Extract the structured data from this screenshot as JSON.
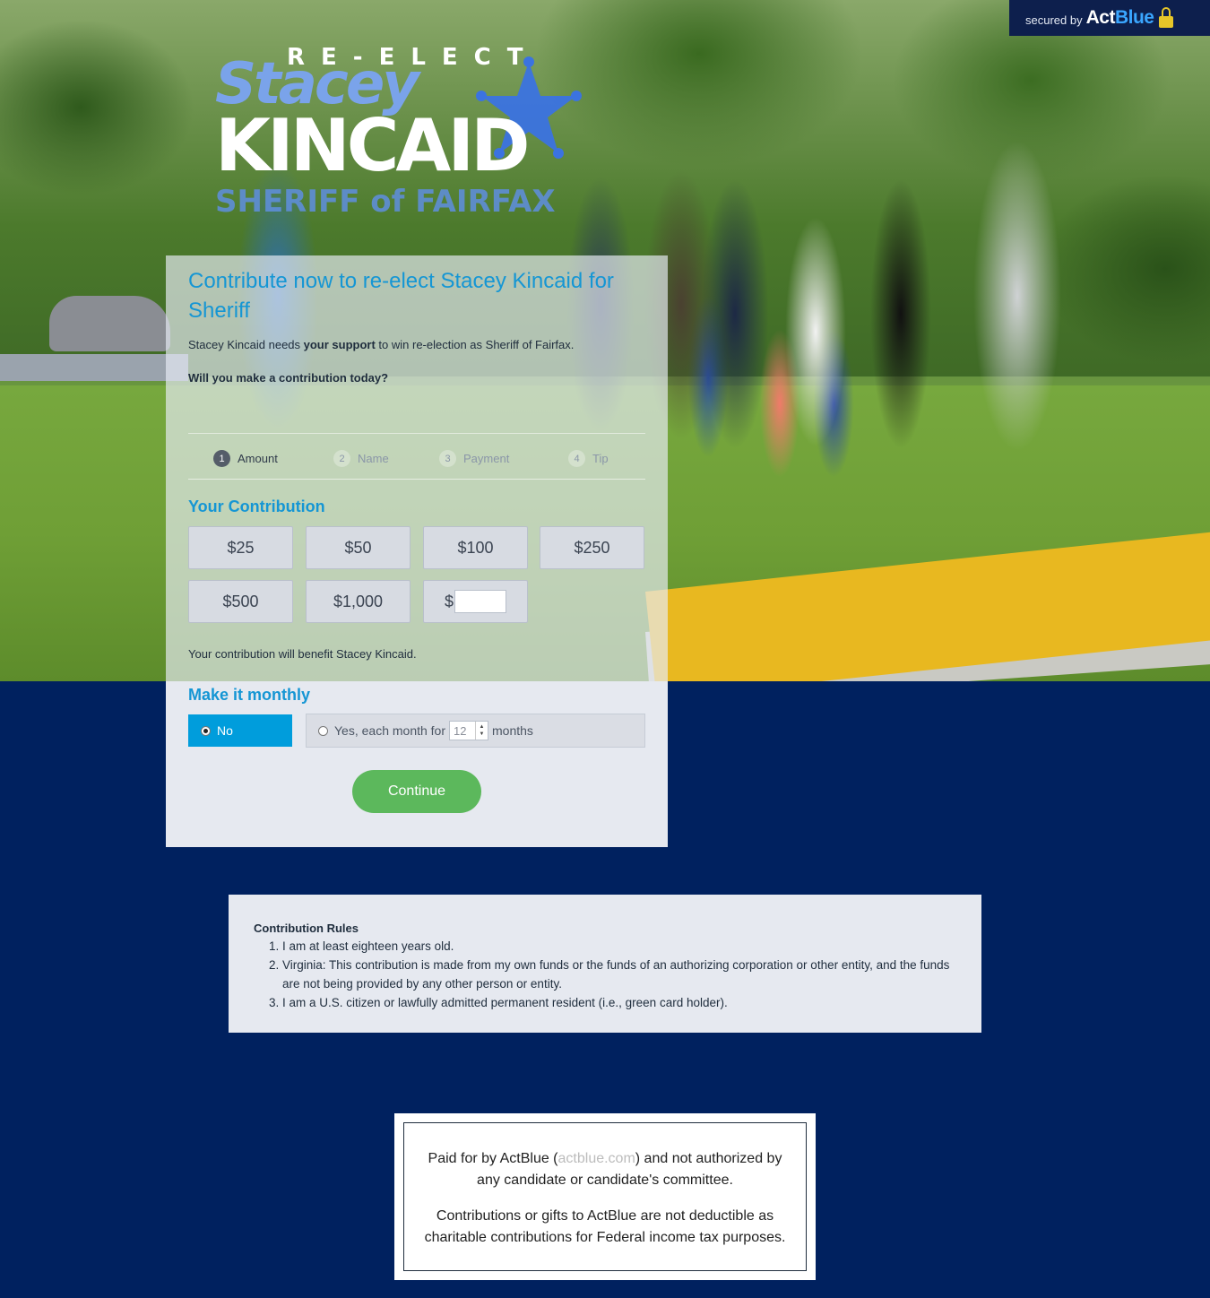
{
  "badge": {
    "secured_by": "secured by",
    "brand_act": "Act",
    "brand_blue": "Blue"
  },
  "logo": {
    "reelect": "RE-ELECT",
    "first": "Stacey",
    "last": "KINCAID",
    "subtitle": "SHERIFF of FAIRFAX"
  },
  "form": {
    "headline": "Contribute now to re-elect Stacey Kincaid for Sheriff",
    "intro_before": "Stacey Kincaid needs ",
    "intro_bold": "your support",
    "intro_after": " to win re-election as Sheriff of Fairfax.",
    "ask": "Will you make a contribution today?",
    "steps": [
      {
        "num": "1",
        "label": "Amount",
        "active": true
      },
      {
        "num": "2",
        "label": "Name",
        "active": false
      },
      {
        "num": "3",
        "label": "Payment",
        "active": false
      },
      {
        "num": "4",
        "label": "Tip",
        "active": false
      }
    ],
    "contribution_title": "Your Contribution",
    "amounts": [
      "$25",
      "$50",
      "$100",
      "$250",
      "$500",
      "$1,000"
    ],
    "custom_currency": "$",
    "custom_value": "",
    "benefit": "Your contribution will benefit Stacey Kincaid.",
    "monthly_title": "Make it monthly",
    "monthly_no": "No",
    "monthly_yes_prefix": "Yes, each month for",
    "monthly_months_value": "12",
    "monthly_yes_suffix": "months",
    "continue": "Continue"
  },
  "rules": {
    "title": "Contribution Rules",
    "items": [
      "I am at least eighteen years old.",
      "Virginia: This contribution is made from my own funds or the funds of an authorizing corporation or other entity, and the funds are not being provided by any other person or entity.",
      "I am a U.S. citizen or lawfully admitted permanent resident (i.e., green card holder)."
    ]
  },
  "disclaimer": {
    "p1_before": "Paid for by ActBlue (",
    "p1_link": "actblue.com",
    "p1_after": ") and not authorized by any candidate or candidate's committee.",
    "p2": "Contributions or gifts to ActBlue are not deductible as charitable contributions for Federal income tax purposes."
  },
  "colors": {
    "page_bg": "#00215f",
    "accent": "#1596d4",
    "selected_option": "#009ddc",
    "continue_button": "#5cb85c"
  }
}
